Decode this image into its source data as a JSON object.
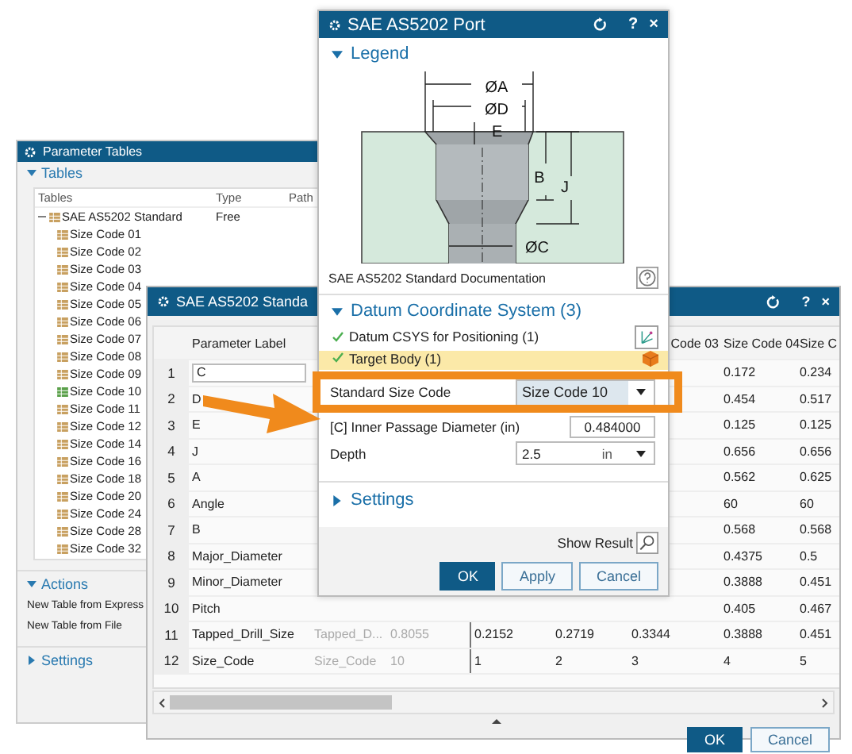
{
  "parameter_tables": {
    "title": "Parameter Tables",
    "tables_section": {
      "label": "Tables",
      "expanded": true
    },
    "columns": [
      "Tables",
      "Type",
      "Path"
    ],
    "tree": {
      "label": "SAE AS5202 Standard",
      "type": "Free",
      "expanded": true,
      "children": [
        {
          "label": "Size Code 01",
          "selected": false
        },
        {
          "label": "Size Code 02",
          "selected": false
        },
        {
          "label": "Size Code 03",
          "selected": false
        },
        {
          "label": "Size Code 04",
          "selected": false
        },
        {
          "label": "Size Code 05",
          "selected": false
        },
        {
          "label": "Size Code 06",
          "selected": false
        },
        {
          "label": "Size Code 07",
          "selected": false
        },
        {
          "label": "Size Code 08",
          "selected": false
        },
        {
          "label": "Size Code 09",
          "selected": false
        },
        {
          "label": "Size Code 10",
          "selected": true
        },
        {
          "label": "Size Code 11",
          "selected": false
        },
        {
          "label": "Size Code 12",
          "selected": false
        },
        {
          "label": "Size Code 14",
          "selected": false
        },
        {
          "label": "Size Code 16",
          "selected": false
        },
        {
          "label": "Size Code 18",
          "selected": false
        },
        {
          "label": "Size Code 20",
          "selected": false
        },
        {
          "label": "Size Code 24",
          "selected": false
        },
        {
          "label": "Size Code 28",
          "selected": false
        },
        {
          "label": "Size Code 32",
          "selected": false
        }
      ]
    },
    "actions_section": {
      "label": "Actions",
      "expanded": true,
      "items": [
        "New Table from Express",
        "New Table from File"
      ]
    },
    "settings_section": {
      "label": "Settings",
      "expanded": false
    }
  },
  "table_dialog": {
    "title": "SAE AS5202 Standa",
    "title_buttons": [
      "?",
      "×"
    ],
    "column_headings": {
      "parameter_label": "Parameter Label",
      "size_code_03": "Code 03",
      "size_code_04": "Size Code 04",
      "size_code_05": "Size C"
    },
    "rows": [
      {
        "index": "1",
        "editing": true,
        "cells": {
          "parameter_label": "C",
          "size_code_04": "0.172",
          "size_code_05": "0.234"
        }
      },
      {
        "index": "2",
        "editing": false,
        "cells": {
          "parameter_label": "D",
          "size_code_04": "0.454",
          "size_code_05": "0.517"
        }
      },
      {
        "index": "3",
        "editing": false,
        "cells": {
          "parameter_label": "E",
          "size_code_04": "0.125",
          "size_code_05": "0.125"
        }
      },
      {
        "index": "4",
        "editing": false,
        "cells": {
          "parameter_label": "J",
          "size_code_04": "0.656",
          "size_code_05": "0.656"
        }
      },
      {
        "index": "5",
        "editing": false,
        "cells": {
          "parameter_label": "A",
          "size_code_04": "0.562",
          "size_code_05": "0.625"
        }
      },
      {
        "index": "6",
        "editing": false,
        "cells": {
          "parameter_label": "Angle",
          "size_code_04": "60",
          "size_code_05": "60"
        }
      },
      {
        "index": "7",
        "editing": false,
        "cells": {
          "parameter_label": "B",
          "size_code_04": "0.568",
          "size_code_05": "0.568"
        }
      },
      {
        "index": "8",
        "editing": false,
        "cells": {
          "parameter_label": "Major_Diameter",
          "size_code_04": "0.4375",
          "size_code_05": "0.5"
        }
      },
      {
        "index": "9",
        "editing": false,
        "cells": {
          "parameter_label": "Minor_Diameter",
          "size_code_04": "0.3888",
          "size_code_05": "0.451"
        }
      },
      {
        "index": "10",
        "editing": false,
        "cells": {
          "parameter_label": "Pitch",
          "size_code_04": "0.405",
          "size_code_05": "0.467"
        }
      },
      {
        "index": "11",
        "editing": false,
        "cells": {
          "parameter_label": "Tapped_Drill_Size",
          "expression": "Tapped_D...",
          "value": "0.8055",
          "size_code_01": "0.2152",
          "size_code_02": "0.2719",
          "size_code_03": "0.3344",
          "size_code_04": "0.3888",
          "size_code_05": "0.451"
        }
      },
      {
        "index": "12",
        "editing": false,
        "cells": {
          "parameter_label": "Size_Code",
          "expression": "Size_Code",
          "value": "10",
          "size_code_01": "1",
          "size_code_02": "2",
          "size_code_03": "3",
          "size_code_04": "4",
          "size_code_05": "5"
        }
      }
    ],
    "buttons": [
      {
        "label": "OK",
        "primary": true
      },
      {
        "label": "Cancel",
        "primary": false
      }
    ]
  },
  "port_dialog": {
    "title": "SAE AS5202 Port",
    "title_buttons": [
      "?",
      "×"
    ],
    "legend": {
      "label": "Legend",
      "expanded": true,
      "labels": [
        "ØA",
        "ØD",
        "E",
        "B",
        "J",
        "ØC"
      ],
      "doc_link": "SAE AS5202 Standard Documentation"
    },
    "datum": {
      "label": "Datum Coordinate System (3)",
      "expanded": true,
      "items": [
        {
          "label": "Datum CSYS for Positioning (1)",
          "selected": false,
          "kind": "csys"
        },
        {
          "label": "Target Body (1)",
          "selected": true,
          "kind": "body"
        }
      ]
    },
    "fields": [
      {
        "kind": "dropdown",
        "label": "Standard Size Code",
        "value": "Size Code 10",
        "highlighted": true
      },
      {
        "kind": "number",
        "label": "[C] Inner Passage Diameter (in)",
        "value": "0.484000",
        "highlighted": false
      },
      {
        "kind": "unit",
        "label": "Depth",
        "value": "2.5",
        "unit": "in",
        "highlighted": false
      }
    ],
    "settings": {
      "label": "Settings",
      "expanded": false
    },
    "show_result": "Show Result",
    "buttons": [
      {
        "label": "OK",
        "primary": true
      },
      {
        "label": "Apply",
        "primary": false
      },
      {
        "label": "Cancel",
        "primary": false
      }
    ]
  }
}
